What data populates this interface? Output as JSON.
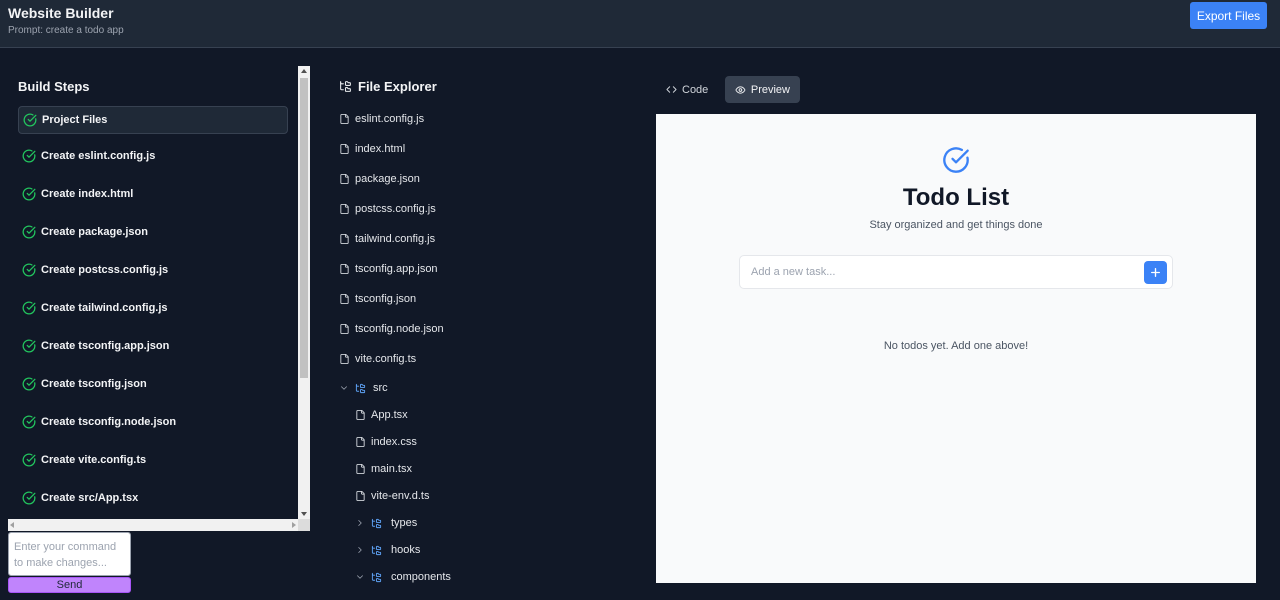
{
  "header": {
    "title": "Website Builder",
    "prompt": "Prompt: create a todo app",
    "export_label": "Export Files"
  },
  "steps": {
    "title": "Build Steps",
    "items": [
      "Project Files",
      "Create eslint.config.js",
      "Create index.html",
      "Create package.json",
      "Create postcss.config.js",
      "Create tailwind.config.js",
      "Create tsconfig.app.json",
      "Create tsconfig.json",
      "Create tsconfig.node.json",
      "Create vite.config.ts",
      "Create src/App.tsx"
    ],
    "active_index": 0
  },
  "command": {
    "placeholder": "Enter your command to make changes...",
    "send_label": "Send"
  },
  "explorer": {
    "title": "File Explorer",
    "root_files": [
      "eslint.config.js",
      "index.html",
      "package.json",
      "postcss.config.js",
      "tailwind.config.js",
      "tsconfig.app.json",
      "tsconfig.json",
      "tsconfig.node.json",
      "vite.config.ts"
    ],
    "src_folder": "src",
    "src_files": [
      "App.tsx",
      "index.css",
      "main.tsx",
      "vite-env.d.ts"
    ],
    "src_folders": [
      {
        "name": "types",
        "expanded": false
      },
      {
        "name": "hooks",
        "expanded": false
      },
      {
        "name": "components",
        "expanded": true
      }
    ]
  },
  "tabs": {
    "code_label": "Code",
    "preview_label": "Preview",
    "active": "preview"
  },
  "preview": {
    "title": "Todo List",
    "subtitle": "Stay organized and get things done",
    "input_placeholder": "Add a new task...",
    "empty_message": "No todos yet. Add one above!"
  },
  "colors": {
    "background": "#111827",
    "header": "#1f2937",
    "accent_blue": "#3b82f6",
    "check_green": "#22c55e",
    "send_purple": "#c084fc"
  }
}
